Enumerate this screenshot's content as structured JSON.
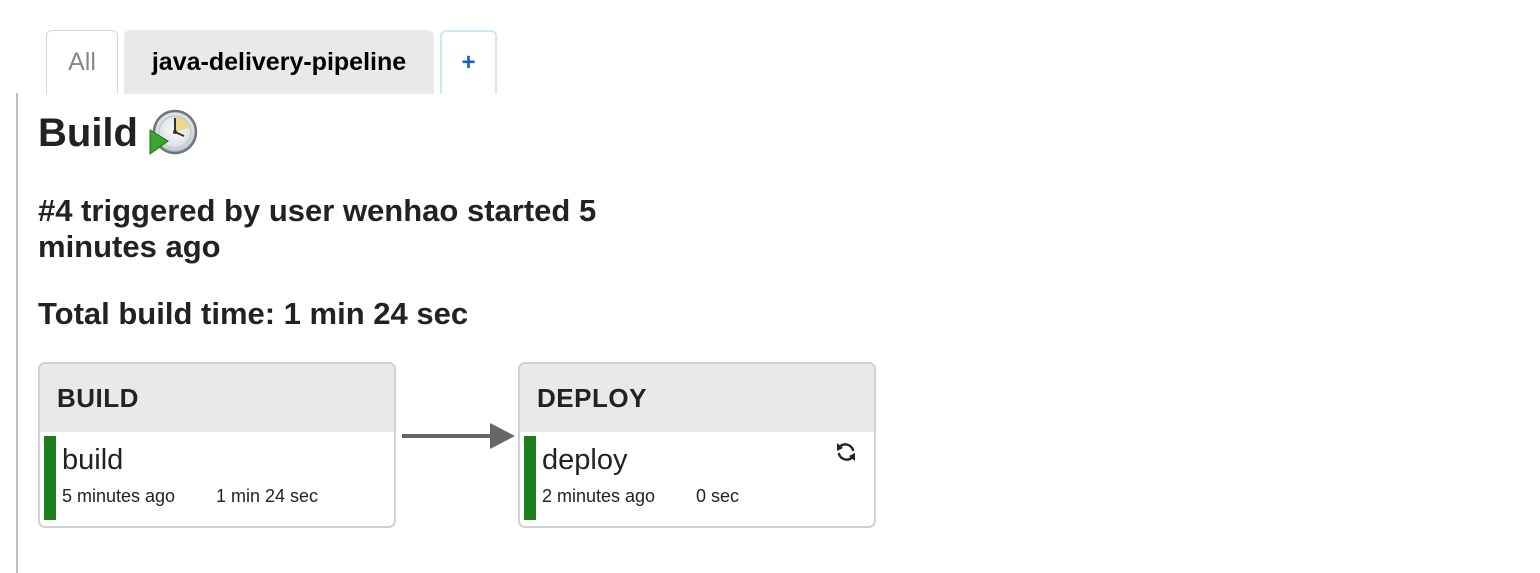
{
  "tabs": [
    {
      "label": "All"
    },
    {
      "label": "java-delivery-pipeline"
    },
    {
      "label": "+"
    }
  ],
  "page": {
    "title": "Build",
    "title_icon": "build-in-progress-icon",
    "trigger_text": "#4 triggered by user wenhao started 5 minutes ago",
    "total_time_text": "Total build time: 1 min 24 sec"
  },
  "stages": [
    {
      "header": "BUILD",
      "job": {
        "name": "build",
        "started": "5 minutes ago",
        "duration": "1 min 24 sec",
        "status_color": "#1d7d1d"
      }
    },
    {
      "header": "DEPLOY",
      "job": {
        "name": "deploy",
        "started": "2 minutes ago",
        "duration": "0 sec",
        "status_color": "#1d7d1d",
        "action_icon": "refresh-icon"
      }
    }
  ],
  "colors": {
    "success": "#1d7d1d",
    "tab_active_bg": "#e9e9e9",
    "add_tab_text": "#1f5fbf"
  }
}
